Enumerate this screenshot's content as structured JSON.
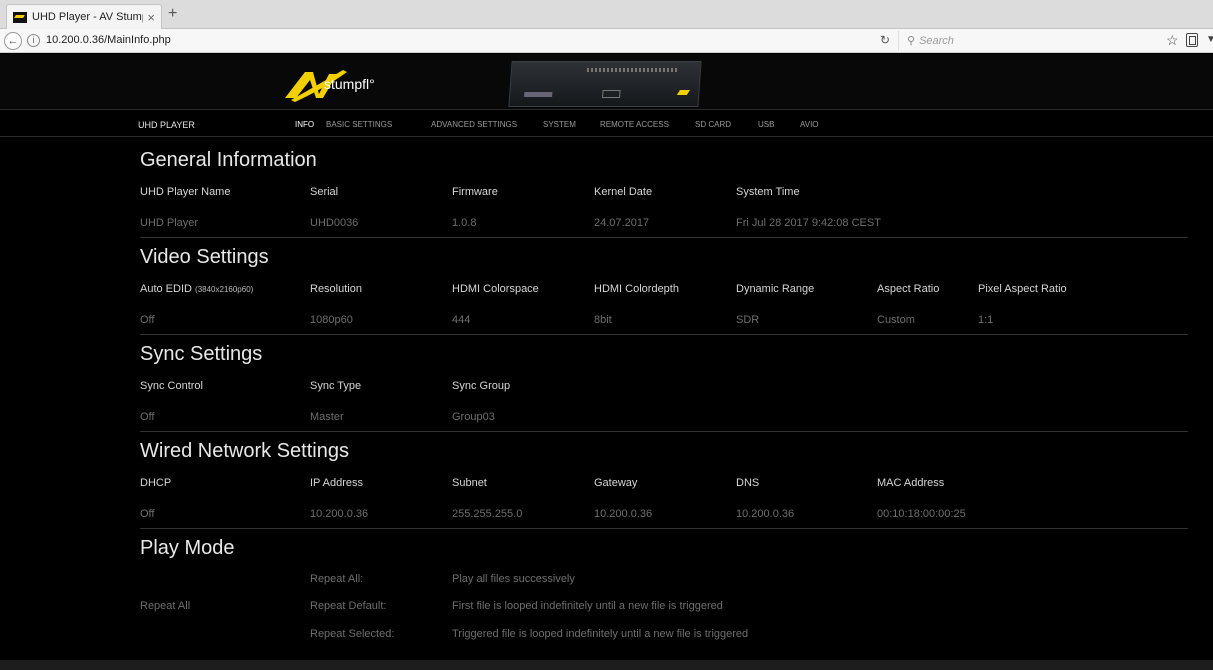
{
  "browser": {
    "tab_title": "UHD Player - AV Stumpfl",
    "tab_close": "×",
    "new_tab": "+",
    "url": "10.200.0.36/MainInfo.php",
    "search_placeholder": "Search"
  },
  "header": {
    "logo_text": "stumpfl°",
    "brand": "UHD PLAYER",
    "accent_color": "#f2d000"
  },
  "menu": {
    "info": "INFO",
    "basic_settings": "BASIC SETTINGS",
    "advanced_settings": "ADVANCED SETTINGS",
    "system": "SYSTEM",
    "remote_access": "REMOTE ACCESS",
    "sd_card": "SD CARD",
    "usb": "USB",
    "avio": "AVIO"
  },
  "general": {
    "title": "General Information",
    "labels": [
      "UHD Player Name",
      "Serial",
      "Firmware",
      "Kernel Date",
      "System Time"
    ],
    "values": [
      "UHD Player",
      "UHD0036",
      "1.0.8",
      "24.07.2017",
      "Fri Jul 28 2017 9:42:08 CEST"
    ]
  },
  "video": {
    "title": "Video Settings",
    "auto_edid_label": "Auto EDID",
    "auto_edid_note": "(3840x2160p60)",
    "labels": [
      "Resolution",
      "HDMI Colorspace",
      "HDMI Colordepth",
      "Dynamic Range",
      "Aspect Ratio",
      "Pixel Aspect Ratio"
    ],
    "values": [
      "Off",
      "1080p60",
      "444",
      "8bit",
      "SDR",
      "Custom",
      "1:1"
    ]
  },
  "sync": {
    "title": "Sync Settings",
    "labels": [
      "Sync Control",
      "Sync Type",
      "Sync Group"
    ],
    "values": [
      "Off",
      "Master",
      "Group03"
    ]
  },
  "network": {
    "title": "Wired Network Settings",
    "labels": [
      "DHCP",
      "IP Address",
      "Subnet",
      "Gateway",
      "DNS",
      "MAC Address"
    ],
    "values": [
      "Off",
      "10.200.0.36",
      "255.255.255.0",
      "10.200.0.36",
      "10.200.0.36",
      "00:10:18:00:00:25"
    ]
  },
  "playmode": {
    "title": "Play Mode",
    "current": "Repeat All",
    "options": [
      {
        "name": "Repeat All:",
        "desc": "Play all files successively"
      },
      {
        "name": "Repeat Default:",
        "desc": "First file is looped indefinitely until a new file is triggered"
      },
      {
        "name": "Repeat Selected:",
        "desc": "Triggered file is looped indefinitely until a new file is triggered"
      }
    ]
  }
}
